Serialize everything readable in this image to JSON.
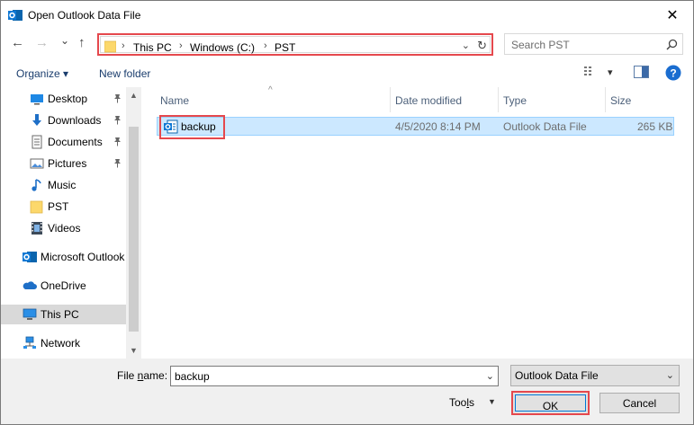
{
  "window": {
    "title": "Open Outlook Data File",
    "close_glyph": "✕"
  },
  "nav": {
    "back_glyph": "←",
    "forward_glyph": "→",
    "recent_glyph": "⌄",
    "up_glyph": "↑"
  },
  "address": {
    "crumbs": [
      "This PC",
      "Windows (C:)",
      "PST"
    ],
    "sep_glyph": "›",
    "dropdown_glyph": "⌄",
    "refresh_glyph": "↻"
  },
  "search": {
    "placeholder": "Search PST"
  },
  "toolbar": {
    "organize_label": "Organize",
    "organize_caret": "▾",
    "new_folder_label": "New folder",
    "view_caret": "▾",
    "help_glyph": "?"
  },
  "sidebar": {
    "items": [
      {
        "label": "Desktop",
        "icon": "desktop-icon",
        "pinned": true
      },
      {
        "label": "Downloads",
        "icon": "download-icon",
        "pinned": true
      },
      {
        "label": "Documents",
        "icon": "documents-icon",
        "pinned": true
      },
      {
        "label": "Pictures",
        "icon": "pictures-icon",
        "pinned": true
      },
      {
        "label": "Music",
        "icon": "music-icon",
        "pinned": false
      },
      {
        "label": "PST",
        "icon": "folder-icon",
        "pinned": false
      },
      {
        "label": "Videos",
        "icon": "videos-icon",
        "pinned": false
      },
      {
        "label": "Microsoft Outlook",
        "icon": "outlook-icon",
        "pinned": false
      },
      {
        "label": "OneDrive",
        "icon": "onedrive-icon",
        "pinned": false
      },
      {
        "label": "This PC",
        "icon": "computer-icon",
        "pinned": false,
        "selected": true
      },
      {
        "label": "Network",
        "icon": "network-icon",
        "pinned": false
      }
    ],
    "pin_glyph": "📌",
    "scroll_up_glyph": "▲",
    "scroll_down_glyph": "▼"
  },
  "columns": {
    "name": "Name",
    "date_modified": "Date modified",
    "type": "Type",
    "size": "Size",
    "sort_glyph": "^"
  },
  "files": [
    {
      "name": "backup",
      "date_modified": "4/5/2020 8:14 PM",
      "type": "Outlook Data File",
      "size": "265 KB",
      "selected": true
    }
  ],
  "footer": {
    "file_name_label_pre": "File ",
    "file_name_label_ul": "n",
    "file_name_label_post": "ame:",
    "file_name_value": "backup",
    "dropdown_glyph": "⌄",
    "filter_value": "Outlook Data File",
    "tools_label_pre": "Too",
    "tools_label_ul": "l",
    "tools_label_post": "s",
    "tools_caret": "▼",
    "ok_label": "OK",
    "cancel_label": "Cancel"
  },
  "colors": {
    "highlight_box": "#e5484d",
    "selection_bg": "#cce8ff",
    "accent": "#0078d7"
  }
}
